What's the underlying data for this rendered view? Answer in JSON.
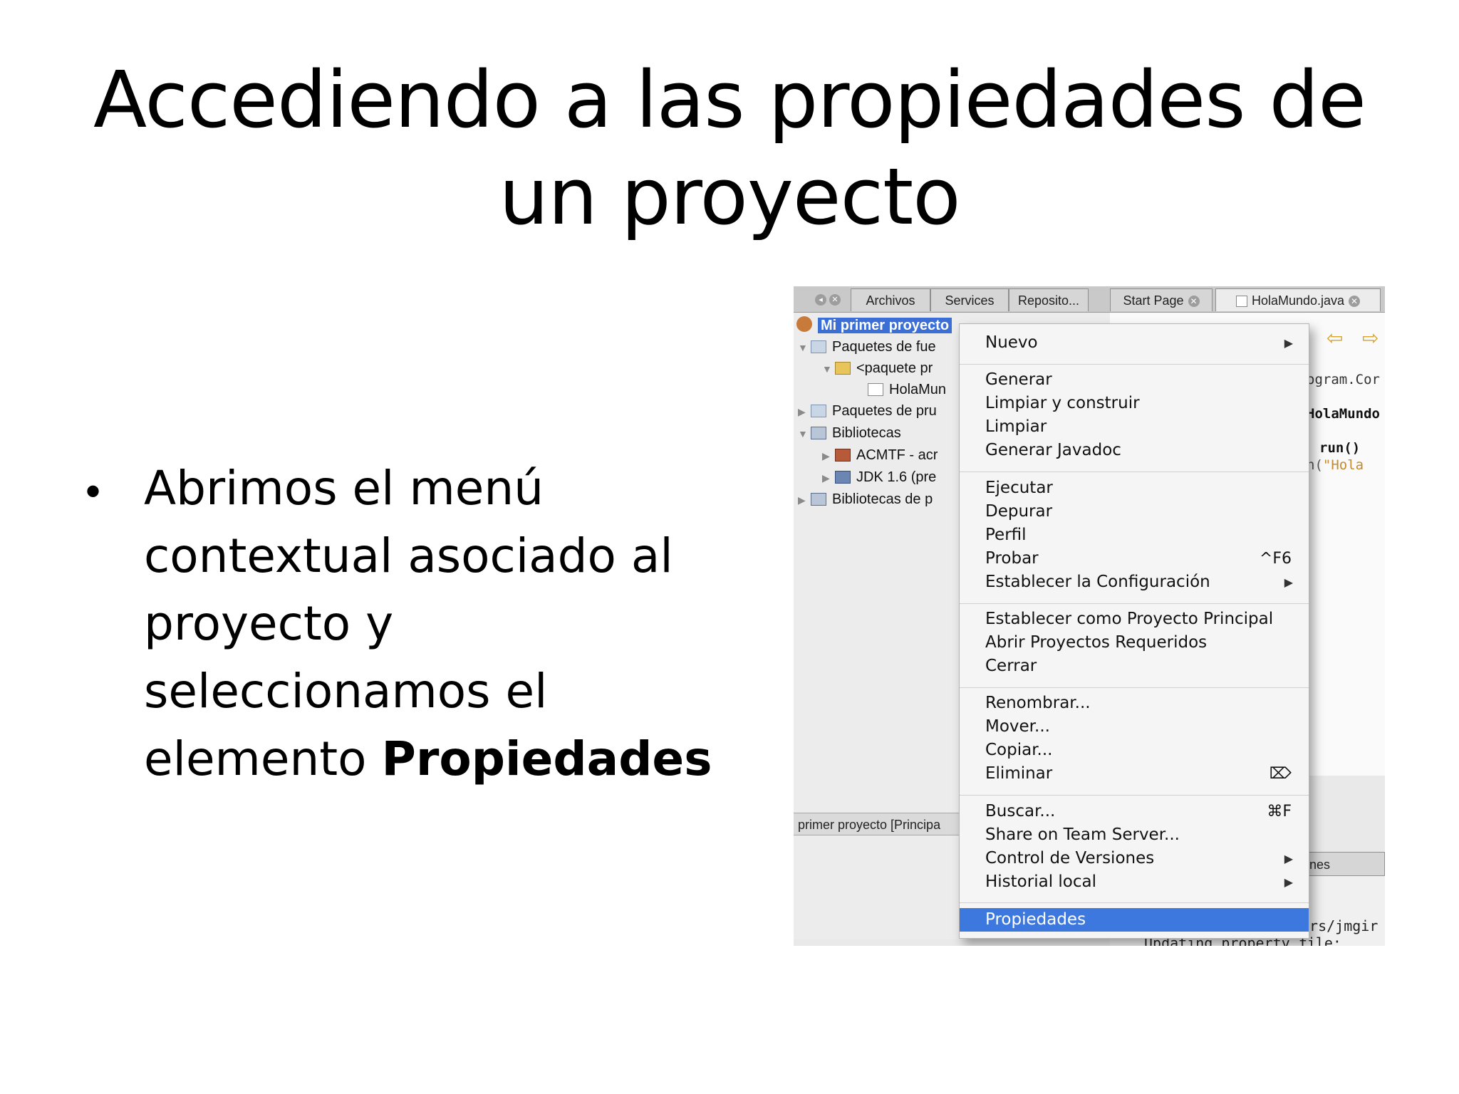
{
  "slide": {
    "title": "Accediendo a las propiedades de un proyecto",
    "bullet_text": "Abrimos el menú contextual asociado al proyecto y seleccionamos el elemento ",
    "bullet_bold": "Propiedades"
  },
  "ide": {
    "tabs": [
      "Archivos",
      "Services",
      "Reposito...",
      "Start Page",
      "HolaMundo.java"
    ],
    "tree": [
      {
        "label": "Mi primer proyecto"
      },
      {
        "label": "Paquetes de fue"
      },
      {
        "label": "<paquete pr"
      },
      {
        "label": "HolaMun"
      },
      {
        "label": "Paquetes de pru"
      },
      {
        "label": "Bibliotecas"
      },
      {
        "label": "ACMTF - acr"
      },
      {
        "label": "JDK 1.6 (pre"
      },
      {
        "label": "Bibliotecas de p"
      }
    ],
    "navigator_label": "primer proyecto [Principa",
    "code": {
      "line1": "ogram.Cor",
      "line2": "HolaMundo",
      "line3": "run()",
      "line4_prefix": "n(",
      "line4_str": "\"Hola"
    },
    "output_tab": "e versiones",
    "output_lines": [
      "ers/jmgir",
      "Updating property file: "
    ]
  },
  "context_menu": {
    "items": [
      {
        "label": "Nuevo",
        "submenu": true
      },
      {
        "label": "Generar"
      },
      {
        "label": "Limpiar y construir"
      },
      {
        "label": "Limpiar"
      },
      {
        "label": "Generar Javadoc"
      },
      {
        "label": "Ejecutar"
      },
      {
        "label": "Depurar"
      },
      {
        "label": "Perfil"
      },
      {
        "label": "Probar",
        "shortcut": "^F6"
      },
      {
        "label": "Establecer la Configuración",
        "submenu": true
      },
      {
        "label": "Establecer como Proyecto Principal"
      },
      {
        "label": "Abrir Proyectos Requeridos"
      },
      {
        "label": "Cerrar"
      },
      {
        "label": "Renombrar..."
      },
      {
        "label": "Mover..."
      },
      {
        "label": "Copiar..."
      },
      {
        "label": "Eliminar",
        "shortcut": "⌦"
      },
      {
        "label": "Buscar...",
        "shortcut": "⌘F"
      },
      {
        "label": "Share on Team Server..."
      },
      {
        "label": "Control de Versiones",
        "submenu": true
      },
      {
        "label": "Historial local",
        "submenu": true
      },
      {
        "label": "Propiedades",
        "highlighted": true
      }
    ],
    "submenu_arrow": "▶"
  },
  "colors": {
    "selection": "#3b6fd6",
    "menu_highlight": "#3d78de"
  }
}
